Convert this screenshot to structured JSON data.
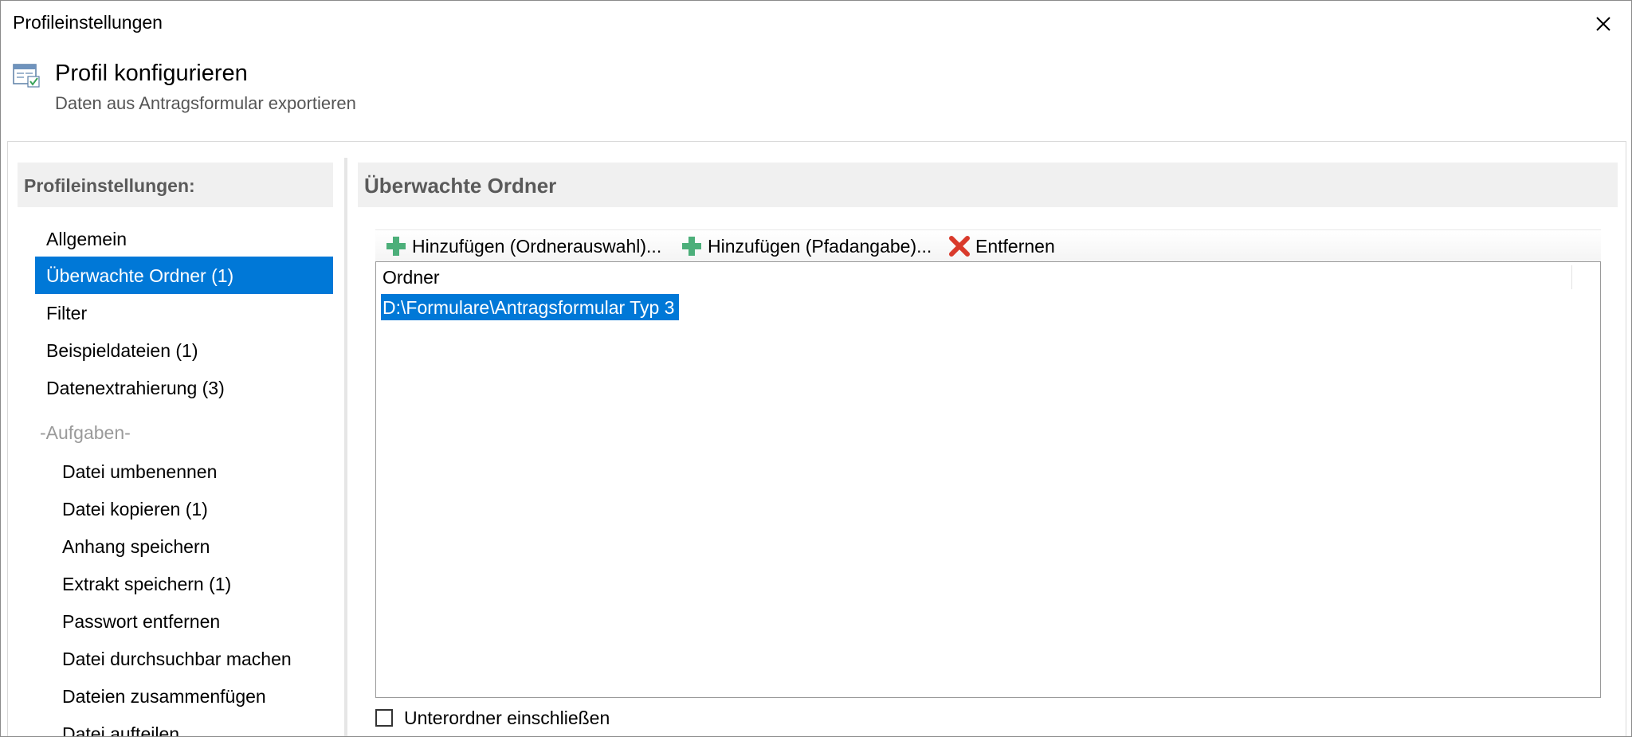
{
  "window": {
    "title": "Profileinstellungen"
  },
  "header": {
    "title": "Profil konfigurieren",
    "subtitle": "Daten aus Antragsformular exportieren",
    "icon": "profile-settings-icon"
  },
  "sidebar": {
    "header": "Profileinstellungen:",
    "items": [
      {
        "label": "Allgemein",
        "selected": false
      },
      {
        "label": "Überwachte Ordner (1)",
        "selected": true
      },
      {
        "label": "Filter",
        "selected": false
      },
      {
        "label": "Beispieldateien (1)",
        "selected": false
      },
      {
        "label": "Datenextrahierung (3)",
        "selected": false
      }
    ],
    "group_label": "-Aufgaben-",
    "tasks": [
      {
        "label": "Datei umbenennen"
      },
      {
        "label": "Datei kopieren (1)"
      },
      {
        "label": "Anhang speichern"
      },
      {
        "label": "Extrakt speichern (1)"
      },
      {
        "label": "Passwort entfernen"
      },
      {
        "label": "Datei durchsuchbar machen"
      },
      {
        "label": "Dateien zusammenfügen"
      },
      {
        "label": "Datei aufteilen"
      }
    ]
  },
  "panel": {
    "title": "Überwachte Ordner",
    "toolbar": {
      "add_select_label": "Hinzufügen (Ordnerauswahl)...",
      "add_path_label": "Hinzufügen (Pfadangabe)...",
      "remove_label": "Entfernen"
    },
    "list": {
      "column_header": "Ordner",
      "rows": [
        {
          "path": "D:\\Formulare\\Antragsformular Typ 3",
          "selected": true
        }
      ]
    },
    "include_subfolders": {
      "label": "Unterordner einschließen",
      "checked": false
    }
  },
  "colors": {
    "selection": "#0078d7",
    "add_icon": "#4caf7a",
    "remove_icon": "#d93a2b"
  }
}
